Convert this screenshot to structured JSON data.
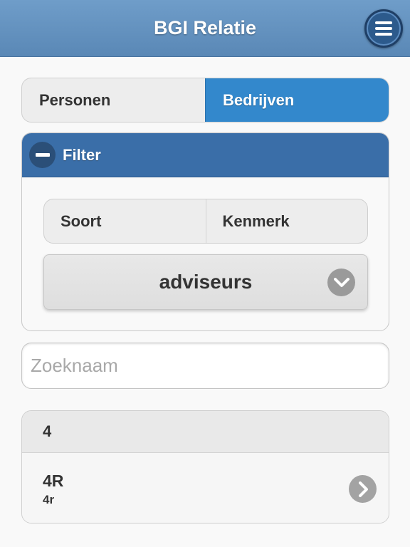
{
  "header": {
    "title": "BGI Relatie",
    "menu_icon": "hamburger-menu-icon"
  },
  "top_segments": [
    {
      "label": "Personen",
      "active": false
    },
    {
      "label": "Bedrijven",
      "active": true
    }
  ],
  "filter": {
    "title": "Filter",
    "collapse_icon": "minus-icon",
    "segments": [
      {
        "label": "Soort"
      },
      {
        "label": "Kenmerk"
      }
    ],
    "select": {
      "value": "adviseurs",
      "icon": "chevron-down-icon"
    }
  },
  "search": {
    "placeholder": "Zoeknaam",
    "value": ""
  },
  "list": {
    "divider": "4",
    "items": [
      {
        "title": "4R",
        "subtitle": "4r",
        "icon": "chevron-right-icon"
      }
    ]
  },
  "colors": {
    "header": "#5f8fbf",
    "accent": "#3388cc",
    "filter_header": "#3a6ea8"
  }
}
